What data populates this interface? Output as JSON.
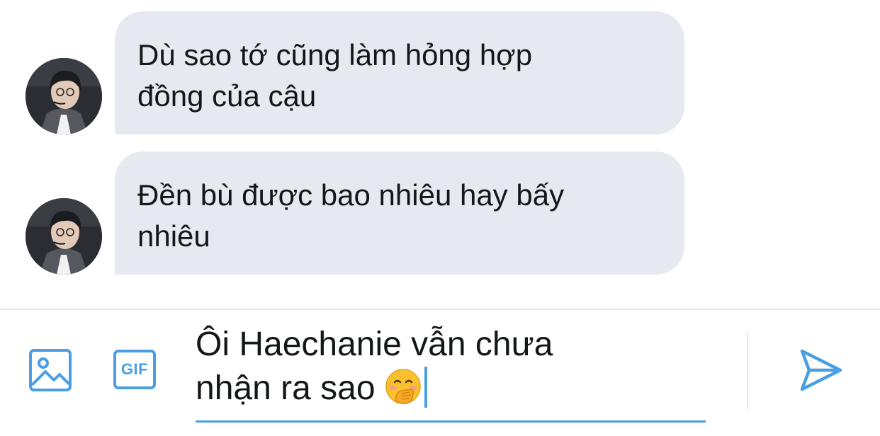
{
  "messages": [
    {
      "sender": "other",
      "avatar_icon": "user-avatar-photo",
      "text_line1": "Dù sao tớ cũng làm hỏng hợp",
      "text_line2": "đồng của cậu"
    },
    {
      "sender": "other",
      "avatar_icon": "user-avatar-photo",
      "text_line1": "Đền bù được bao nhiêu hay bấy",
      "text_line2": "nhiêu"
    }
  ],
  "composer": {
    "image_icon": "image-icon",
    "gif_label": "GIF",
    "draft_line1": "Ôi Haechanie vẫn chưa",
    "draft_line2": "nhận ra sao",
    "draft_emoji": "face-with-hand-over-mouth",
    "send_icon": "send-icon"
  },
  "colors": {
    "accent": "#4a9ee3",
    "bubble_bg": "#e6e9ef",
    "text": "#14171a",
    "divider": "#e1e5ea"
  }
}
